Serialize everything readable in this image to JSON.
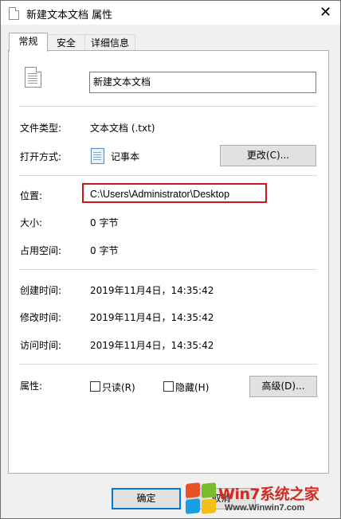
{
  "window": {
    "title": "新建文本文档 属性",
    "close_glyph": "✕"
  },
  "tabs": [
    {
      "label": "常规",
      "active": true
    },
    {
      "label": "安全",
      "active": false
    },
    {
      "label": "详细信息",
      "active": false
    }
  ],
  "general": {
    "file_name": "新建文本文档",
    "file_type_label": "文件类型:",
    "file_type_value": "文本文档 (.txt)",
    "opens_with_label": "打开方式:",
    "opens_with_value": "记事本",
    "change_button": "更改(C)...",
    "location_label": "位置:",
    "location_value": "C:\\Users\\Administrator\\Desktop",
    "size_label": "大小:",
    "size_value": "0 字节",
    "size_on_disk_label": "占用空间:",
    "size_on_disk_value": "0 字节",
    "created_label": "创建时间:",
    "created_value": "2019年11月4日，14:35:42",
    "modified_label": "修改时间:",
    "modified_value": "2019年11月4日，14:35:42",
    "accessed_label": "访问时间:",
    "accessed_value": "2019年11月4日，14:35:42",
    "attributes_label": "属性:",
    "readonly_label": "只读(R)",
    "hidden_label": "隐藏(H)",
    "advanced_button": "高级(D)..."
  },
  "footer": {
    "ok_button": "确定",
    "cancel_button": "取消"
  },
  "watermark": {
    "brand_text": "Win7系统之家",
    "url_text": "Www.Winwin7.com"
  },
  "colors": {
    "highlight": "#c8161d",
    "accent": "#0078d7"
  }
}
